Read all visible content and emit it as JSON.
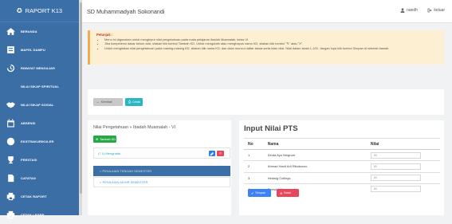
{
  "app": {
    "brand": "RAPORT K13"
  },
  "sidebar": {
    "items": [
      {
        "label": "BERANDA",
        "icon": "home-icon"
      },
      {
        "label": "MAPEL DAMPU",
        "icon": "book-icon"
      },
      {
        "label": "RIWAYAT MENGAJAR",
        "icon": "history-icon"
      },
      {
        "label": "NILAI SIKAP SPIRITUAL",
        "icon": "spiritual-icon"
      },
      {
        "label": "NILAI SIKAP SOSIAL",
        "icon": "handshake-icon"
      },
      {
        "label": "ABSENSI",
        "icon": "calendar-icon"
      },
      {
        "label": "EKSTRAKURIKULER",
        "icon": "soccer-icon"
      },
      {
        "label": "PRESTASI",
        "icon": "trophy-icon"
      },
      {
        "label": "CATATAN",
        "icon": "note-icon"
      },
      {
        "label": "CETAK RAPORT",
        "icon": "print-icon"
      },
      {
        "label": "CETAK LEGER",
        "icon": "print-icon"
      }
    ]
  },
  "topbar": {
    "school": "SD Muhammadyah Sokonandi",
    "user": "nandh",
    "logout": "keluar"
  },
  "notice": {
    "title": "Petunjuk :",
    "lines": [
      "Menu ini digunakan untuk menginput nilai pengetahuan pada mata pelajaran Ibadah Muamalah, kelas VI.",
      "Jika kompetensi dasar belum ada, silakan klik tombol Tambah KD. Untuk mengubah atau menghapus nama KD, silakan klik tombol \"✎\" atau \"X\".",
      "Untuk mengisikan nilai pengetahuan pada masing-masing KD, silakan klik nama KD, dan akan muncul daftar siswa serta isian nilai. Nilai dalam skala 1-100. Jangan lupa klik tombol Simpan di sebelah bawah."
    ]
  },
  "buttons": {
    "back": "Kembali",
    "print": "Cetak",
    "add_kd": "Tambah KD",
    "save": "Simpan",
    "cancel": "Batal"
  },
  "left": {
    "title": "Nilai Pengetahuan » Ibadah Muamalah - VI",
    "kd_item": "(7.1) Menghafal",
    "semesters": [
      "> PENILAIAN TENGAH SEMESTER",
      "> PENILAIAN AKHIR SEMESTER"
    ]
  },
  "right": {
    "title": "Input Nilai PTS",
    "columns": [
      "No",
      "Nama",
      "Nilai"
    ],
    "rows": [
      {
        "no": "1",
        "nama": "Dinda Ayu Ningrum",
        "nilai_placeholder": "80"
      },
      {
        "no": "2",
        "nama": "Ahmad Hanif Adi Rikaksono",
        "nilai_placeholder": "80"
      },
      {
        "no": "3",
        "nama": "Hedwig Collings",
        "nilai_placeholder": "80"
      },
      {
        "no": "4",
        "nama": "Reese Inkle",
        "nilai_placeholder": "80"
      }
    ]
  },
  "colors": {
    "sidebar": "#3a6ea5",
    "accent_teal": "#2ab6c6",
    "success": "#27a844",
    "primary": "#3b82f6",
    "danger": "#e8465a",
    "warning_bg": "#fdf0d2"
  }
}
